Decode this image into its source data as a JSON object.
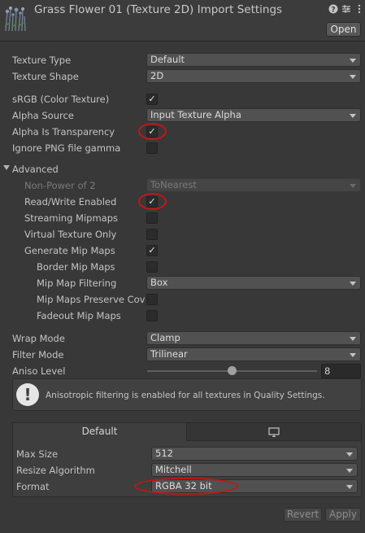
{
  "header": {
    "title": "Grass Flower 01 (Texture 2D) Import Settings",
    "open_label": "Open",
    "icons": [
      "help-icon",
      "preset-icon",
      "more-icon"
    ]
  },
  "fields": {
    "texture_type": {
      "label": "Texture Type",
      "value": "Default"
    },
    "texture_shape": {
      "label": "Texture Shape",
      "value": "2D"
    },
    "srgb": {
      "label": "sRGB (Color Texture)",
      "checked": true
    },
    "alpha_source": {
      "label": "Alpha Source",
      "value": "Input Texture Alpha"
    },
    "alpha_is_transparency": {
      "label": "Alpha Is Transparency",
      "checked": true
    },
    "ignore_png_gamma": {
      "label": "Ignore PNG file gamma",
      "checked": false
    }
  },
  "advanced": {
    "label": "Advanced",
    "non_power_of_2": {
      "label": "Non-Power of 2",
      "value": "ToNearest"
    },
    "read_write": {
      "label": "Read/Write Enabled",
      "checked": true
    },
    "streaming_mipmaps": {
      "label": "Streaming Mipmaps",
      "checked": false
    },
    "virtual_texture_only": {
      "label": "Virtual Texture Only",
      "checked": false
    },
    "generate_mip_maps": {
      "label": "Generate Mip Maps",
      "checked": true
    },
    "border_mip_maps": {
      "label": "Border Mip Maps",
      "checked": false
    },
    "mip_map_filtering": {
      "label": "Mip Map Filtering",
      "value": "Box"
    },
    "mip_maps_preserve_coverage": {
      "label": "Mip Maps Preserve Cov",
      "checked": false
    },
    "fadeout_mip_maps": {
      "label": "Fadeout Mip Maps",
      "checked": false
    }
  },
  "wrap_mode": {
    "label": "Wrap Mode",
    "value": "Clamp"
  },
  "filter_mode": {
    "label": "Filter Mode",
    "value": "Trilinear"
  },
  "aniso_level": {
    "label": "Aniso Level",
    "value": "8",
    "fraction": 0.5
  },
  "help": {
    "text": "Anisotropic filtering is enabled for all textures in Quality Settings.",
    "icon": "info-icon"
  },
  "platform": {
    "tabs": [
      {
        "label": "Default"
      },
      {
        "label": "",
        "icon": "monitor-icon"
      }
    ],
    "max_size": {
      "label": "Max Size",
      "value": "512"
    },
    "resize_algorithm": {
      "label": "Resize Algorithm",
      "value": "Mitchell"
    },
    "format": {
      "label": "Format",
      "value": "RGBA 32 bit"
    }
  },
  "footer": {
    "revert_label": "Revert",
    "apply_label": "Apply"
  },
  "colors": {
    "annotation_ring": "#c81414",
    "background": "#383838"
  }
}
